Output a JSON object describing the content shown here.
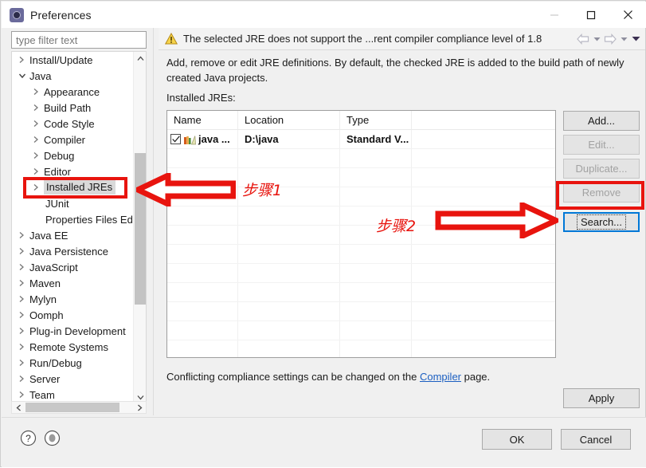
{
  "window": {
    "title": "Preferences",
    "icon": "preferences-gear-icon",
    "controls": {
      "minimize": "minimize-icon",
      "maximize": "maximize-icon",
      "close": "close-icon"
    }
  },
  "sidebar": {
    "filter_placeholder": "type filter text",
    "filter_value": "",
    "items": [
      {
        "label": "Install/Update",
        "level": 1,
        "arrow": "collapsed",
        "selected": false
      },
      {
        "label": "Java",
        "level": 1,
        "arrow": "expanded",
        "selected": false
      },
      {
        "label": "Appearance",
        "level": 2,
        "arrow": "collapsed",
        "selected": false
      },
      {
        "label": "Build Path",
        "level": 2,
        "arrow": "collapsed",
        "selected": false
      },
      {
        "label": "Code Style",
        "level": 2,
        "arrow": "collapsed",
        "selected": false
      },
      {
        "label": "Compiler",
        "level": 2,
        "arrow": "collapsed",
        "selected": false
      },
      {
        "label": "Debug",
        "level": 2,
        "arrow": "collapsed",
        "selected": false
      },
      {
        "label": "Editor",
        "level": 2,
        "arrow": "collapsed",
        "selected": false
      },
      {
        "label": "Installed JREs",
        "level": 2,
        "arrow": "collapsed",
        "selected": true
      },
      {
        "label": "JUnit",
        "level": 2,
        "arrow": "none",
        "selected": false
      },
      {
        "label": "Properties Files Ed",
        "level": 2,
        "arrow": "none",
        "selected": false
      },
      {
        "label": "Java EE",
        "level": 1,
        "arrow": "collapsed",
        "selected": false
      },
      {
        "label": "Java Persistence",
        "level": 1,
        "arrow": "collapsed",
        "selected": false
      },
      {
        "label": "JavaScript",
        "level": 1,
        "arrow": "collapsed",
        "selected": false
      },
      {
        "label": "Maven",
        "level": 1,
        "arrow": "collapsed",
        "selected": false
      },
      {
        "label": "Mylyn",
        "level": 1,
        "arrow": "collapsed",
        "selected": false
      },
      {
        "label": "Oomph",
        "level": 1,
        "arrow": "collapsed",
        "selected": false
      },
      {
        "label": "Plug-in Development",
        "level": 1,
        "arrow": "collapsed",
        "selected": false
      },
      {
        "label": "Remote Systems",
        "level": 1,
        "arrow": "collapsed",
        "selected": false
      },
      {
        "label": "Run/Debug",
        "level": 1,
        "arrow": "collapsed",
        "selected": false
      },
      {
        "label": "Server",
        "level": 1,
        "arrow": "collapsed",
        "selected": false
      },
      {
        "label": "Team",
        "level": 1,
        "arrow": "collapsed",
        "selected": false
      }
    ]
  },
  "message_bar": {
    "icon": "warning-icon",
    "text": "The selected JRE does not support the ...rent compiler compliance level of 1.8",
    "nav": {
      "back": "back-arrow-icon",
      "back_menu": "caret-down-icon",
      "forward": "forward-arrow-icon",
      "forward_menu": "caret-down-icon",
      "view_menu": "caret-down-filled-icon"
    }
  },
  "main": {
    "description": "Add, remove or edit JRE definitions. By default, the checked JRE is added to the build path of newly created Java projects.",
    "installed_label": "Installed JREs:",
    "table": {
      "columns": [
        "Name",
        "Location",
        "Type",
        ""
      ],
      "rows": [
        {
          "checked": true,
          "icon": "jre-books-icon",
          "name": "java ...",
          "location": "D:\\java",
          "type": "Standard V...",
          "extra": ""
        }
      ],
      "empty_row_count": 12
    },
    "buttons": [
      {
        "id": "add",
        "label": "Add...",
        "mnemonic": "A",
        "enabled": true,
        "focused": false
      },
      {
        "id": "edit",
        "label": "Edit...",
        "mnemonic": "E",
        "enabled": false,
        "focused": false
      },
      {
        "id": "duplicate",
        "label": "Duplicate...",
        "mnemonic": "c",
        "enabled": false,
        "focused": false
      },
      {
        "id": "remove",
        "label": "Remove",
        "mnemonic": "R",
        "enabled": false,
        "focused": false
      },
      {
        "id": "search",
        "label": "Search...",
        "mnemonic": "S",
        "enabled": true,
        "focused": true
      }
    ],
    "compiler_note_prefix": "Conflicting compliance settings can be changed on the ",
    "compiler_link": "Compiler",
    "compiler_note_suffix": " page.",
    "apply_label": "Apply"
  },
  "footer": {
    "help_icon": "help-question-icon",
    "restore_icon": "restore-defaults-icon",
    "ok_label": "OK",
    "cancel_label": "Cancel"
  },
  "annotations": {
    "color": "#e8140e",
    "step1_label": "步骤1",
    "step2_label": "步骤2",
    "highlight_jres": "red-rect-installed-jres",
    "highlight_search": "red-rect-search-button",
    "arrow_left": "red-left-arrow",
    "arrow_right": "red-right-arrow"
  }
}
